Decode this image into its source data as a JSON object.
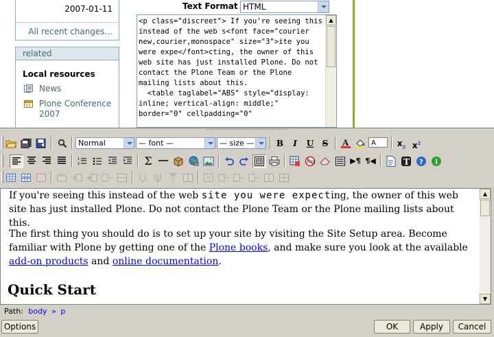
{
  "recent": {
    "date": "2007-01-11",
    "all_changes_link": "All recent changes..."
  },
  "related": {
    "header": "related",
    "local_resources_title": "Local resources",
    "items": [
      {
        "label": "News",
        "icon": "news-icon"
      },
      {
        "label": "Plone Conference 2007",
        "icon": "event-icon"
      }
    ]
  },
  "text_format": {
    "label": "Text Format",
    "value": "HTML"
  },
  "source_html": "<p class=\"discreet\"> If you're seeing this instead of the web s<font face=\"courier new,courier,monospace\" size=\"3\">ite you were expe</font>cting, the owner of this web site has just installed Plone. Do not contact the Plone Team or the Plone mailing lists about this.\n  <table taglabel=\"ABS\" style=\"display: inline; vertical-align: middle;\" border=\"0\" cellpadding=\"0\"",
  "toolbar": {
    "format_select": "Normal",
    "font_select": "— font —",
    "size_select": "— size —",
    "bold": "B",
    "italic": "I",
    "underline": "U",
    "strikethrough": "S",
    "color_value": "A",
    "subscript": "x",
    "superscript": "x"
  },
  "content": {
    "p1_before": "If you're seeing this instead of the web ",
    "p1_mono": "site you were expect",
    "p1_after": "ing, the owner of this web site has just installed Plone. Do not contact the Plone Team or the Plone mailing lists about this.",
    "p2_a": "The first thing you should do is to set up your site by visiting the Site Setup area. Become familiar with Plone by getting one of the ",
    "p2_link1": "Plone books",
    "p2_b": ", and make sure you look at the available ",
    "p2_link2": "add-on products",
    "p2_c": " and ",
    "p2_link3": "online documentation",
    "p2_d": ".",
    "heading": "Quick Start"
  },
  "path_bar": {
    "label": "Path:",
    "body": "body",
    "sep": "»",
    "p": "p"
  },
  "buttons": {
    "options": "Options",
    "ok": "OK",
    "apply": "Apply",
    "cancel": "Cancel"
  }
}
